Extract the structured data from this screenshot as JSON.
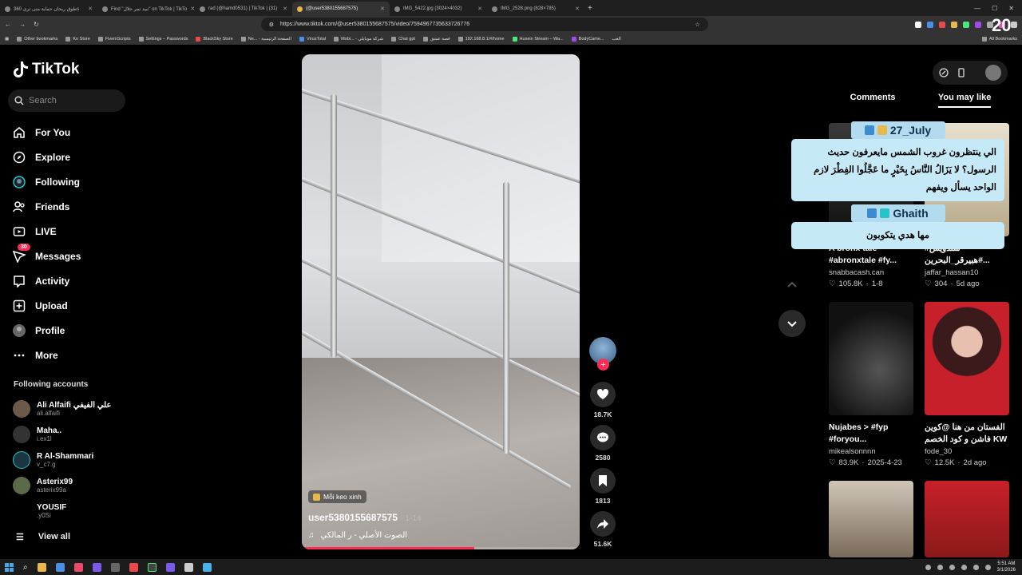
{
  "browser": {
    "tabs": [
      {
        "label": "طوق ربحان حماية متى ترى 360s"
      },
      {
        "label": "Find \"تبيد تمر حلال\" on TikTok | TikTo"
      },
      {
        "label": "rad (@hamd0531) | TikTok | (31)"
      },
      {
        "label": "(@user5380155687575)"
      },
      {
        "label": "IMG_5422.jpg (3024×4032)"
      },
      {
        "label": "IMG_2528.png (828×785)"
      }
    ],
    "url": "https://www.tiktok.com/@user5380155687575/video/7594967735633726776",
    "bookmarks": [
      "Other bookmarks",
      "Ko Store",
      "FivemScripts",
      "Settings – Passwords",
      "BlackSky Store",
      "Ne... - الصفحة الرئيسية",
      "VirusTotal",
      "Mobi... - شركة موبايلي",
      "Chat gpt",
      "قصة عشق",
      "192.168.8.1/#/home",
      "Husein Stream – Wa...",
      "BodyCame...",
      "العب",
      "All Bookmarks"
    ],
    "badge_number": "20"
  },
  "sidebar": {
    "logo": "TikTok",
    "search_placeholder": "Search",
    "nav": [
      {
        "label": "For You",
        "icon": "home-icon"
      },
      {
        "label": "Explore",
        "icon": "compass-icon"
      },
      {
        "label": "Following",
        "icon": "following-icon"
      },
      {
        "label": "Friends",
        "icon": "friends-icon"
      },
      {
        "label": "LIVE",
        "icon": "live-icon"
      },
      {
        "label": "Messages",
        "icon": "messages-icon",
        "badge": "30"
      },
      {
        "label": "Activity",
        "icon": "activity-icon"
      },
      {
        "label": "Upload",
        "icon": "upload-icon"
      },
      {
        "label": "Profile",
        "icon": "profile-icon"
      },
      {
        "label": "More",
        "icon": "more-icon"
      }
    ],
    "following_title": "Following accounts",
    "accounts": [
      {
        "name": "Ali Alfaifi علي الفيفي",
        "handle": "ali.alfaifi"
      },
      {
        "name": "Maha..",
        "handle": "i.ex1l"
      },
      {
        "name": "R Al-Shammari",
        "handle": "v_c7.g"
      },
      {
        "name": "Asterix99",
        "handle": "asterix99a"
      },
      {
        "name": "YOUSIF",
        "handle": ".y0Si"
      }
    ],
    "view_all": "View all"
  },
  "video": {
    "tag": "Mỗi keo xinh",
    "username": "user5380155687575",
    "date": "· 1-14",
    "sound": "الصوت الأصلي - ر المالكي",
    "progress": 0.62
  },
  "actions": {
    "likes": "18.7K",
    "comments": "2580",
    "saves": "1813",
    "shares": "51.6K"
  },
  "right_panel": {
    "tabs": [
      "Comments",
      "You may like"
    ],
    "cards": [
      {
        "title": "A bronx tale #abronxtale #fy...",
        "user": "snabbacash.can",
        "likes": "105.8K",
        "date": "1-8"
      },
      {
        "title": "#سندويش #هبيرقر_البحرين...",
        "user": "jaffar_hassan10",
        "likes": "304",
        "date": "5d ago"
      },
      {
        "title": "Nujabes > #fyp #foryou...",
        "user": "mikealsonnnn",
        "likes": "83.9K",
        "date": "2025-4-23"
      },
      {
        "title": "الفستان من هنا @كوين فاشن و كود الخصم KW",
        "user": "fode_30",
        "likes": "12.5K",
        "date": "2d ago"
      }
    ]
  },
  "overlay": {
    "c1_name": "27_July",
    "c1_text": "الي ينتظرون غروب الشمس مايعرفون حديث الرسول؟ لا يَزَالُ النَّاسُ بِخَيْرٍ ما عَجَّلُوا الفِطْرَ لازم الواحد يسأل ويفهم",
    "c2_name": "Ghaith",
    "c2_text": "مها هدي يتكوبون"
  },
  "taskbar": {
    "time": "5:51 AM",
    "date": "3/1/2026"
  }
}
